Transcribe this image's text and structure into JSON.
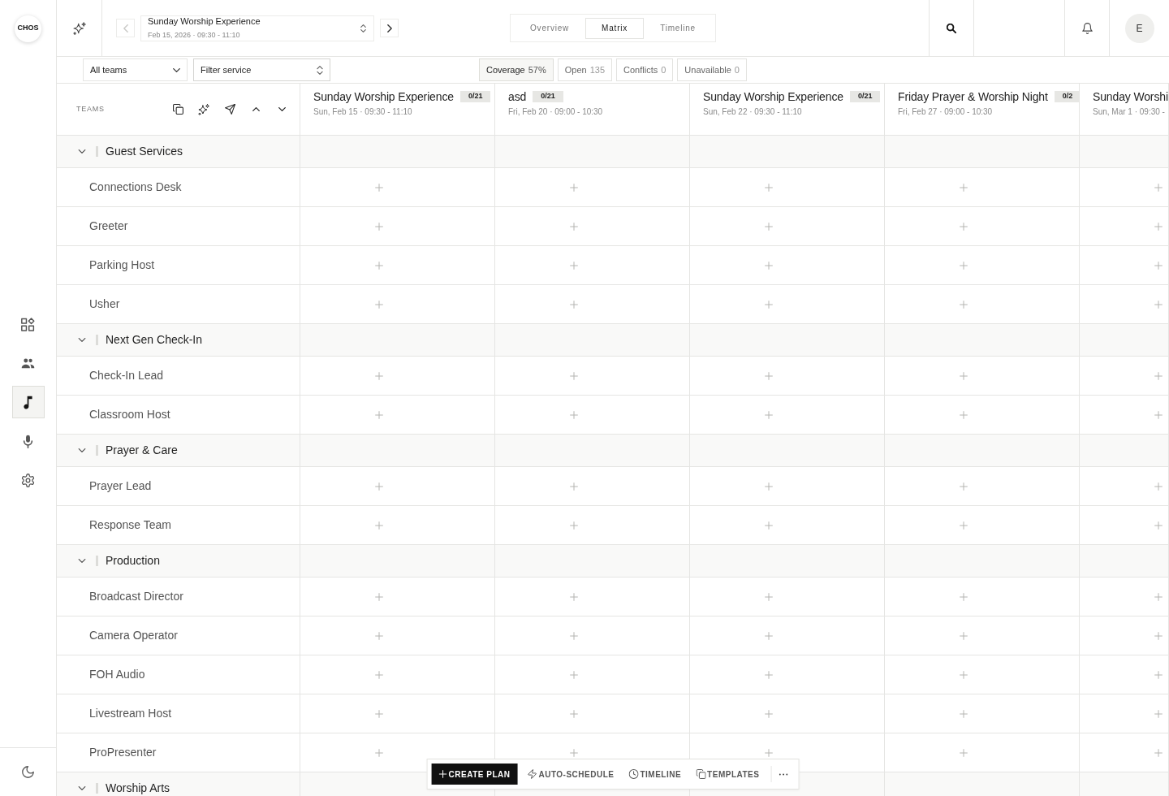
{
  "rail": {
    "logo": "CHOS",
    "nav": [
      {
        "selected": false
      },
      {
        "selected": false
      },
      {
        "selected": true
      },
      {
        "selected": false
      },
      {
        "selected": false
      }
    ]
  },
  "header": {
    "prev_button": {
      "disabled": true
    },
    "service_picker": {
      "title": "Sunday Worship Experience",
      "subtitle": "Feb 15, 2026 · 09:30 - 11:10"
    },
    "next_button": {
      "disabled": false
    },
    "tabs": [
      {
        "label": "Overview",
        "selected": false
      },
      {
        "label": "Matrix",
        "selected": true
      },
      {
        "label": "Timeline",
        "selected": false
      }
    ],
    "avatar": "E"
  },
  "filters": {
    "team_select": {
      "value": "All teams"
    },
    "service_select": {
      "value": "Filter service"
    },
    "chips": [
      {
        "label": "Coverage",
        "count": "57%",
        "selected": true
      },
      {
        "label": "Open",
        "count": "135",
        "selected": false
      },
      {
        "label": "Conflicts",
        "count": "0",
        "selected": false
      },
      {
        "label": "Unavailable",
        "count": "0",
        "selected": false
      }
    ]
  },
  "matrix": {
    "teams_heading": "TEAMS",
    "columns": [
      {
        "title": "Sunday Worship Experience",
        "badge": "0/21",
        "date": "Sun, Feb 15 · 09:30 - 11:10"
      },
      {
        "title": "asd",
        "badge": "0/21",
        "date": "Fri, Feb 20 · 09:00 - 10:30"
      },
      {
        "title": "Sunday Worship Experience",
        "badge": "0/21",
        "date": "Sun, Feb 22 · 09:30 - 11:10"
      },
      {
        "title": "Friday Prayer & Worship Night",
        "badge": "0/2",
        "date": "Fri, Feb 27 · 09:00 - 10:30"
      },
      {
        "title": "Sunday Worshi",
        "date": "Sun, Mar 1 · 09:30 -"
      }
    ],
    "groups": [
      {
        "name": "Guest Services",
        "expanded": true,
        "roles": [
          "Connections Desk",
          "Greeter",
          "Parking Host",
          "Usher"
        ]
      },
      {
        "name": "Next Gen Check-In",
        "expanded": true,
        "roles": [
          "Check-In Lead",
          "Classroom Host"
        ]
      },
      {
        "name": "Prayer & Care",
        "expanded": true,
        "roles": [
          "Prayer Lead",
          "Response Team"
        ]
      },
      {
        "name": "Production",
        "expanded": true,
        "roles": [
          "Broadcast Director",
          "Camera Operator",
          "FOH Audio",
          "Livestream Host",
          "ProPresenter"
        ]
      },
      {
        "name": "Worship Arts",
        "expanded": true
      }
    ]
  },
  "toolbar": {
    "buttons": [
      {
        "label": "CREATE PLAN",
        "kind": "primary"
      },
      {
        "label": "AUTO-SCHEDULE",
        "kind": "ghost"
      },
      {
        "label": "TIMELINE",
        "kind": "ghost"
      },
      {
        "label": "TEMPLATES",
        "kind": "ghost"
      }
    ]
  }
}
